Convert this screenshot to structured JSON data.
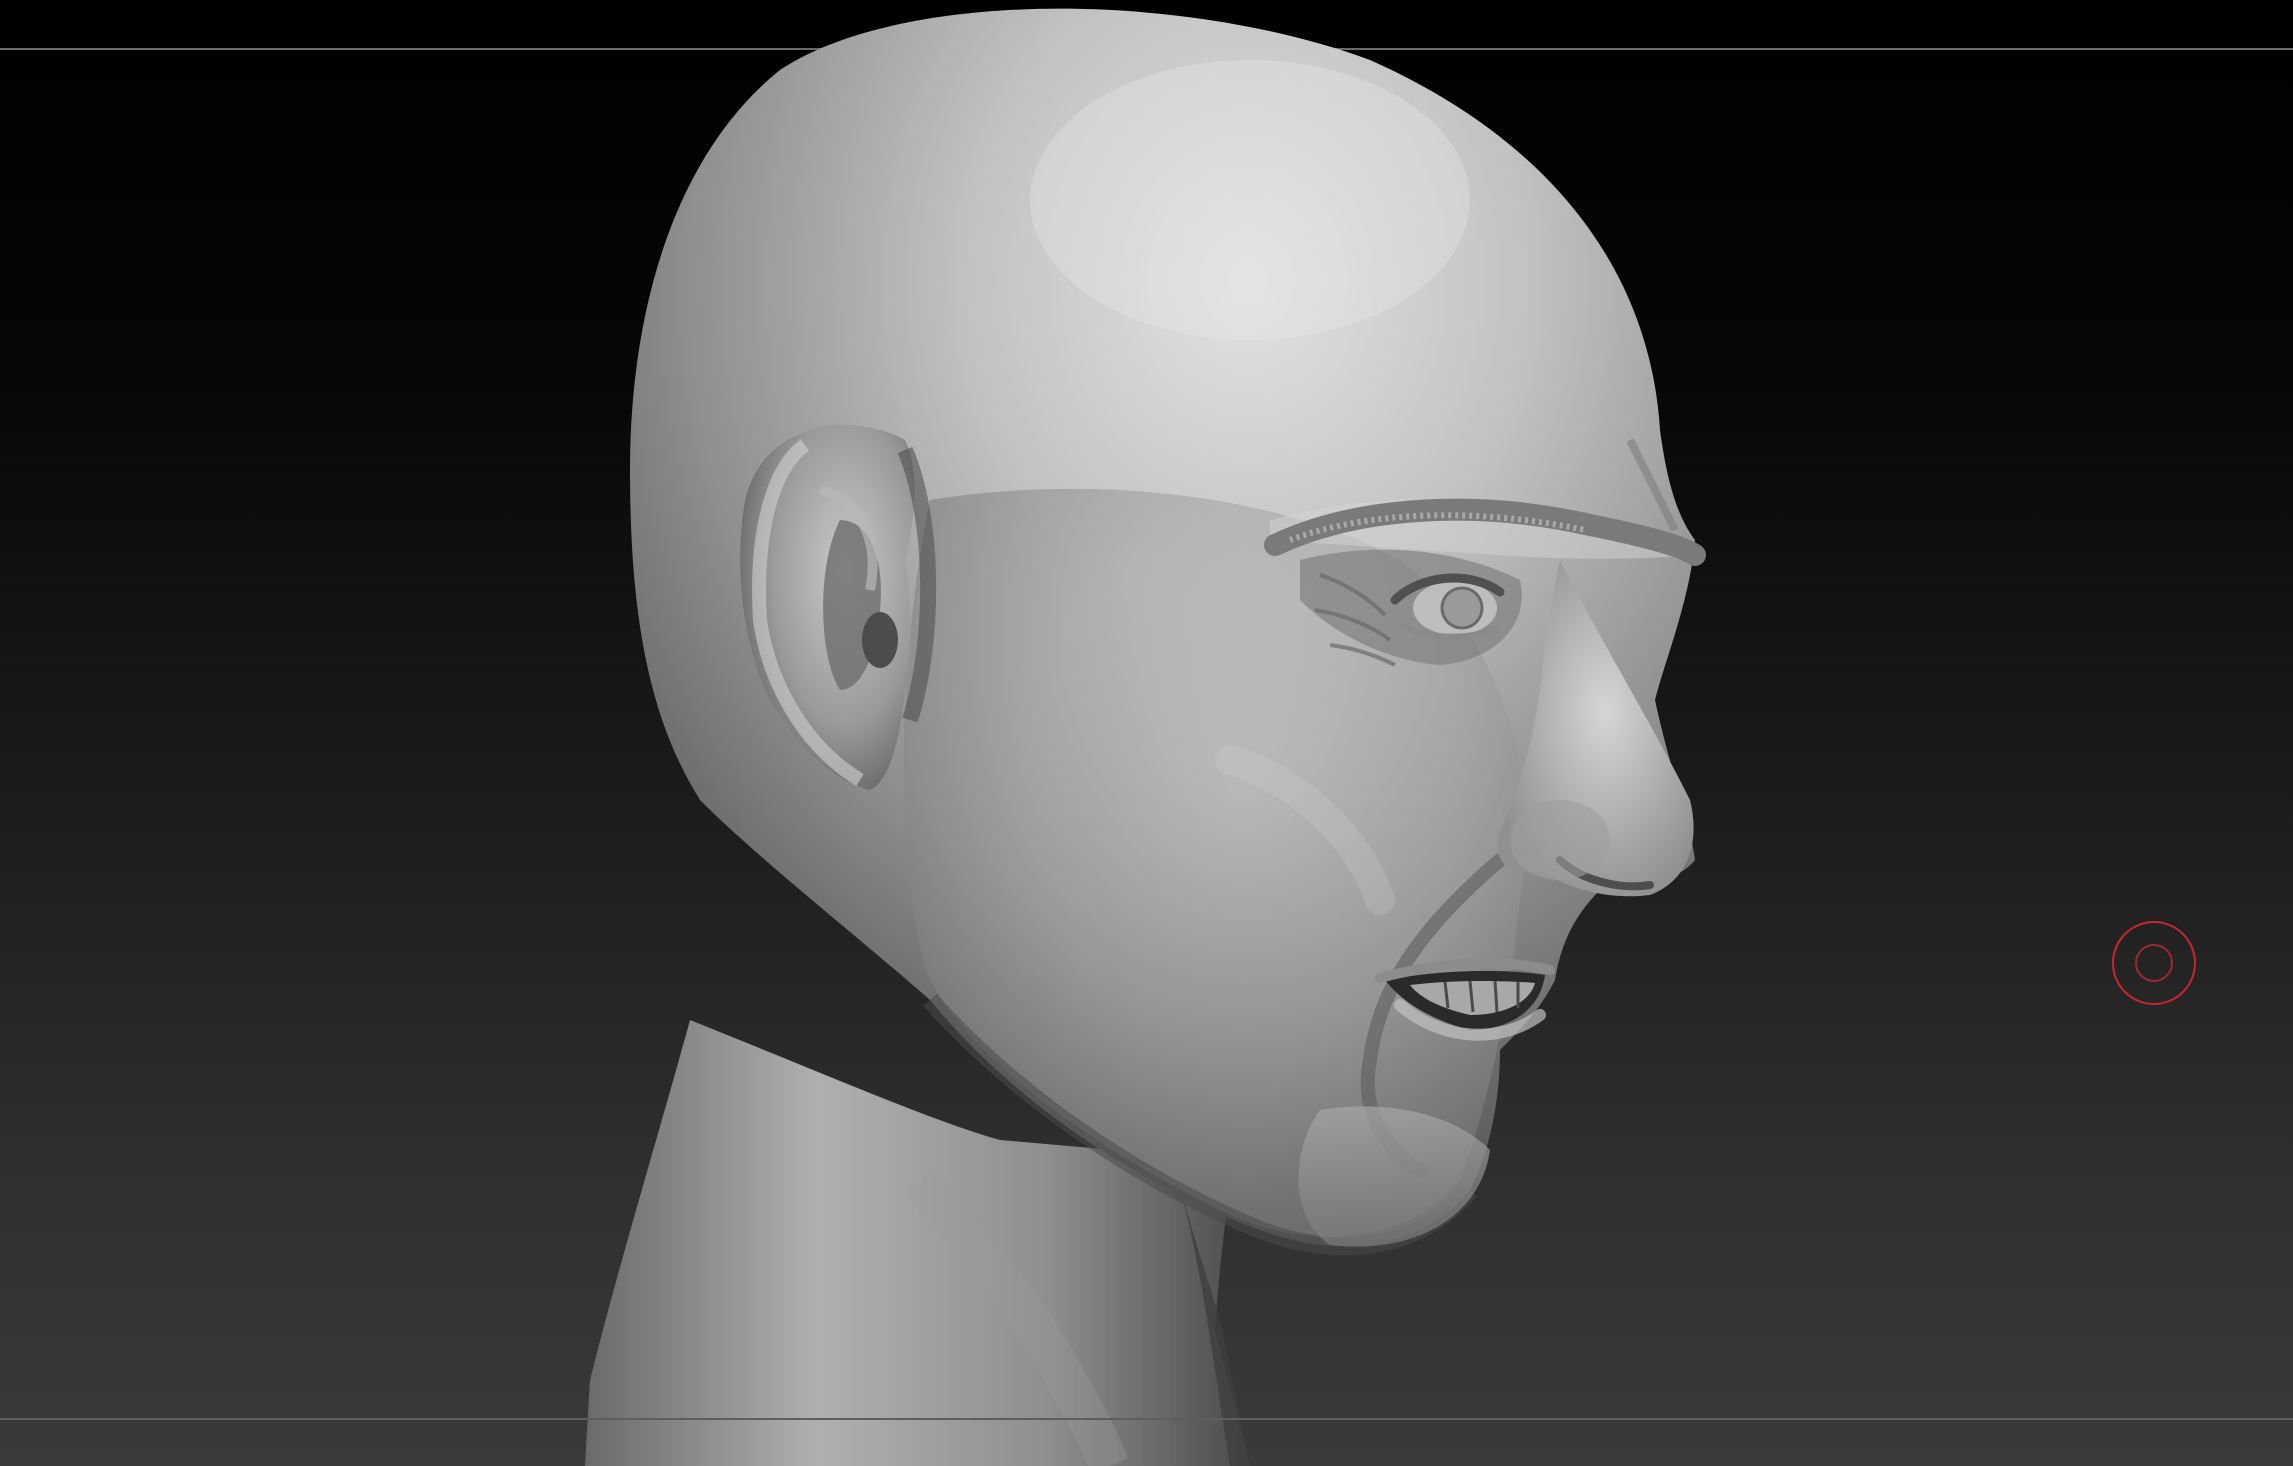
{
  "viewport": {
    "background_top": "#000000",
    "background_bottom": "#3a3a3a",
    "model": "head-sculpt",
    "material_color": "#b4b4b4",
    "brush_cursor_color": "#c8262e",
    "icons": [
      "brush-cursor-icon"
    ]
  }
}
